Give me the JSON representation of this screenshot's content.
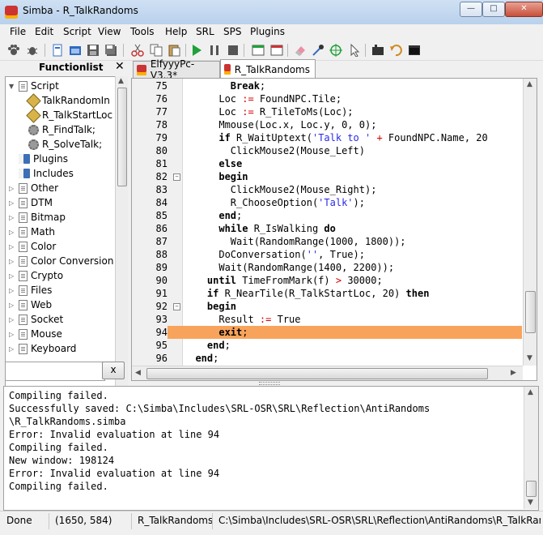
{
  "window": {
    "title": "Simba - R_TalkRandoms",
    "controls": {
      "minimize": "—",
      "maximize": "□",
      "close": "✕"
    }
  },
  "menu": [
    "File",
    "Edit",
    "Script",
    "View",
    "Tools",
    "Help",
    "SRL",
    "SPS",
    "Plugins"
  ],
  "toolbar": {
    "icons": [
      "paw-icon",
      "bug-icon",
      "new-file-icon",
      "open-folder-icon",
      "save-icon",
      "save-all-icon",
      "cut-icon",
      "copy-icon",
      "paste-icon",
      "run-icon",
      "pause-icon",
      "stop-icon",
      "new-tab-icon",
      "close-tab-icon",
      "eraser-icon",
      "color-picker-icon",
      "crosshair-icon",
      "select-client-icon",
      "function-icon",
      "undo-icon",
      "console-icon"
    ]
  },
  "functionlist": {
    "title": "Functionlist",
    "close": "✕",
    "items": [
      {
        "label": "Script",
        "icon": "doc",
        "level": 0,
        "expanded": true
      },
      {
        "label": "TalkRandomIn",
        "icon": "func",
        "level": 1
      },
      {
        "label": "R_TalkStartLoc",
        "icon": "func",
        "level": 1
      },
      {
        "label": "R_FindTalk;",
        "icon": "gear",
        "level": 1
      },
      {
        "label": "R_SolveTalk;",
        "icon": "gear",
        "level": 1
      },
      {
        "label": "Plugins",
        "icon": "book",
        "level": 0
      },
      {
        "label": "Includes",
        "icon": "book",
        "level": 0
      },
      {
        "label": "Other",
        "icon": "doc",
        "level": 0,
        "expander": true
      },
      {
        "label": "DTM",
        "icon": "doc",
        "level": 0,
        "expander": true
      },
      {
        "label": "Bitmap",
        "icon": "doc",
        "level": 0,
        "expander": true
      },
      {
        "label": "Math",
        "icon": "doc",
        "level": 0,
        "expander": true
      },
      {
        "label": "Color",
        "icon": "doc",
        "level": 0,
        "expander": true
      },
      {
        "label": "Color Conversion",
        "icon": "doc",
        "level": 0,
        "expander": true
      },
      {
        "label": "Crypto",
        "icon": "doc",
        "level": 0,
        "expander": true
      },
      {
        "label": "Files",
        "icon": "doc",
        "level": 0,
        "expander": true
      },
      {
        "label": "Web",
        "icon": "doc",
        "level": 0,
        "expander": true
      },
      {
        "label": "Socket",
        "icon": "doc",
        "level": 0,
        "expander": true
      },
      {
        "label": "Mouse",
        "icon": "doc",
        "level": 0,
        "expander": true
      },
      {
        "label": "Keyboard",
        "icon": "doc",
        "level": 0,
        "expander": true
      }
    ],
    "search_value": "",
    "search_clear": "x"
  },
  "tabs": [
    {
      "label": "ElfyyyPc-V3.3*",
      "active": false
    },
    {
      "label": "R_TalkRandoms",
      "active": true
    }
  ],
  "editor": {
    "highlight_line": 94,
    "lines": [
      {
        "n": "75",
        "fold": "",
        "html": "        <span class='kw'>Break</span>;"
      },
      {
        "n": "76",
        "fold": "",
        "html": "      Loc <span class='sym'>:=</span> FoundNPC.Tile;"
      },
      {
        "n": "77",
        "fold": "",
        "html": "      Loc <span class='sym'>:=</span> R_TileToMs(Loc);"
      },
      {
        "n": "78",
        "fold": "",
        "html": "      Mmouse(Loc.x, Loc.y, 0, 0);"
      },
      {
        "n": "79",
        "fold": "",
        "html": "      <span class='kw'>if</span> R_WaitUptext(<span class='str'>'Talk to '</span> <span class='sym'>+</span> FoundNPC.Name, 20"
      },
      {
        "n": "80",
        "fold": "",
        "html": "        ClickMouse2(Mouse_Left)"
      },
      {
        "n": "81",
        "fold": "",
        "html": "      <span class='kw'>else</span>"
      },
      {
        "n": "82",
        "fold": "−",
        "html": "      <span class='kw'>begin</span>"
      },
      {
        "n": "83",
        "fold": "",
        "html": "        ClickMouse2(Mouse_Right);"
      },
      {
        "n": "84",
        "fold": "",
        "html": "        R_ChooseOption(<span class='str'>'Talk'</span>);"
      },
      {
        "n": "85",
        "fold": "",
        "html": "      <span class='kw'>end</span>;"
      },
      {
        "n": "86",
        "fold": "",
        "html": "      <span class='kw'>while</span> R_IsWalking <span class='kw'>do</span>"
      },
      {
        "n": "87",
        "fold": "",
        "html": "        Wait(RandomRange(1000, 1800));"
      },
      {
        "n": "88",
        "fold": "",
        "html": "      DoConversation(<span class='str'>''</span>, True);"
      },
      {
        "n": "89",
        "fold": "",
        "html": "      Wait(RandomRange(1400, 2200));"
      },
      {
        "n": "90",
        "fold": "",
        "html": "    <span class='kw'>until</span> TimeFromMark(f) <span class='sym'>&gt;</span> 30000;"
      },
      {
        "n": "91",
        "fold": "",
        "html": "    <span class='kw'>if</span> R_NearTile(R_TalkStartLoc, 20) <span class='kw'>then</span>"
      },
      {
        "n": "92",
        "fold": "−",
        "html": "    <span class='kw'>begin</span>"
      },
      {
        "n": "93",
        "fold": "",
        "html": "      Result <span class='sym'>:=</span> True"
      },
      {
        "n": "94",
        "fold": "",
        "html": "      <span class='kw'>exit</span>;"
      },
      {
        "n": "95",
        "fold": "",
        "html": "    <span class='kw'>end</span>;"
      },
      {
        "n": "96",
        "fold": "",
        "html": "  <span class='kw'>end</span>;"
      }
    ]
  },
  "output": {
    "lines": [
      "Compiling failed.",
      "Successfully saved: C:\\Simba\\Includes\\SRL-OSR\\SRL\\Reflection\\AntiRandoms",
      "\\R_TalkRandoms.simba",
      "Error: Invalid evaluation at line 94",
      "Compiling failed.",
      "New window: 198124",
      "Error: Invalid evaluation at line 94",
      "Compiling failed."
    ]
  },
  "status": {
    "state": "Done",
    "coords": "(1650, 584)",
    "script": "R_TalkRandoms",
    "path": "C:\\Simba\\Includes\\SRL-OSR\\SRL\\Reflection\\AntiRandoms\\R_TalkRandc"
  }
}
